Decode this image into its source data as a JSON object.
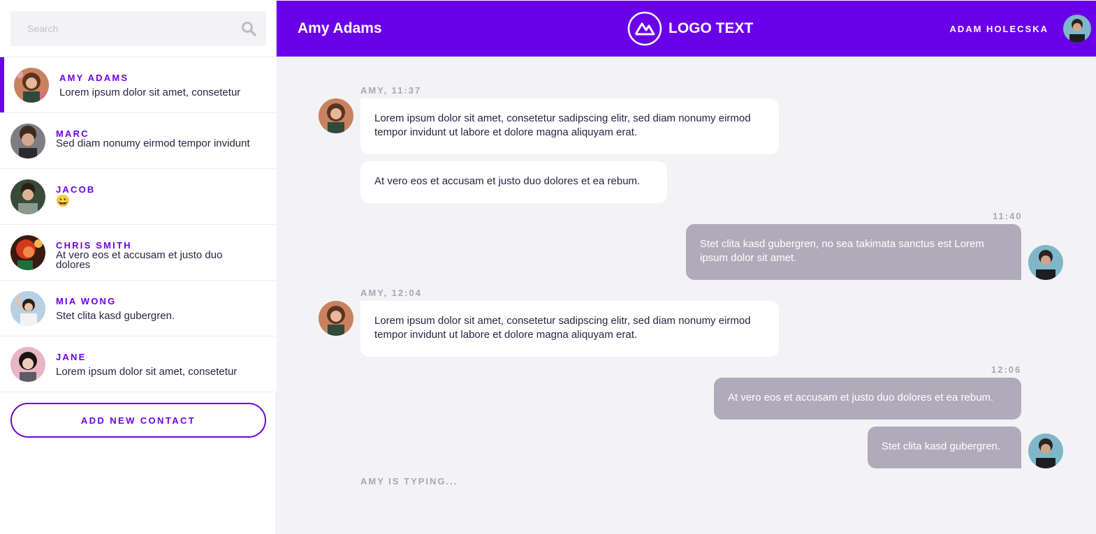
{
  "search": {
    "placeholder": "Search",
    "icon": "search-icon"
  },
  "contacts": [
    {
      "name": "AMY ADAMS",
      "message": "Lorem ipsum dolor sit amet, consetetur",
      "active": true
    },
    {
      "name": "MARC",
      "message": "Sed diam nonumy eirmod tempor invidunt"
    },
    {
      "name": "JACOB",
      "message": "😀"
    },
    {
      "name": "CHRIS SMITH",
      "message": "At vero eos et accusam et justo duo dolores"
    },
    {
      "name": "MIA WONG",
      "message": "Stet clita kasd gubergren."
    },
    {
      "name": "JANE",
      "message": "Lorem ipsum dolor sit amet, consetetur"
    }
  ],
  "add_contact_label": "ADD NEW CONTACT",
  "header": {
    "chat_title": "Amy Adams",
    "logo_text": "LOGO TEXT",
    "user_name": "ADAM HOLECSKA"
  },
  "messages": [
    {
      "meta": "AMY, 11:37",
      "text": "Lorem ipsum dolor sit amet, consetetur sadipscing elitr, sed diam nonumy eirmod tempor invidunt ut labore et dolore magna aliquyam erat."
    },
    {
      "text": "At vero eos et accusam et justo duo dolores et ea rebum."
    },
    {
      "meta": "11:40",
      "text": "Stet clita kasd gubergren, no sea takimata sanctus est Lorem ipsum dolor sit amet."
    },
    {
      "meta": "AMY, 12:04",
      "text": "Lorem ipsum dolor sit amet, consetetur sadipscing elitr, sed diam nonumy eirmod tempor invidunt ut labore et dolore magna aliquyam erat."
    },
    {
      "meta": "12:06",
      "text": "At vero eos et accusam et justo duo dolores et ea rebum."
    },
    {
      "text": "Stet clita kasd gubergren."
    }
  ],
  "typing_indicator": "AMY IS TYPING...",
  "colors": {
    "accent": "#6a00e8",
    "outgoing_bubble": "#b0abbb",
    "incoming_bubble": "#ffffff",
    "background": "#f3f3f5"
  }
}
